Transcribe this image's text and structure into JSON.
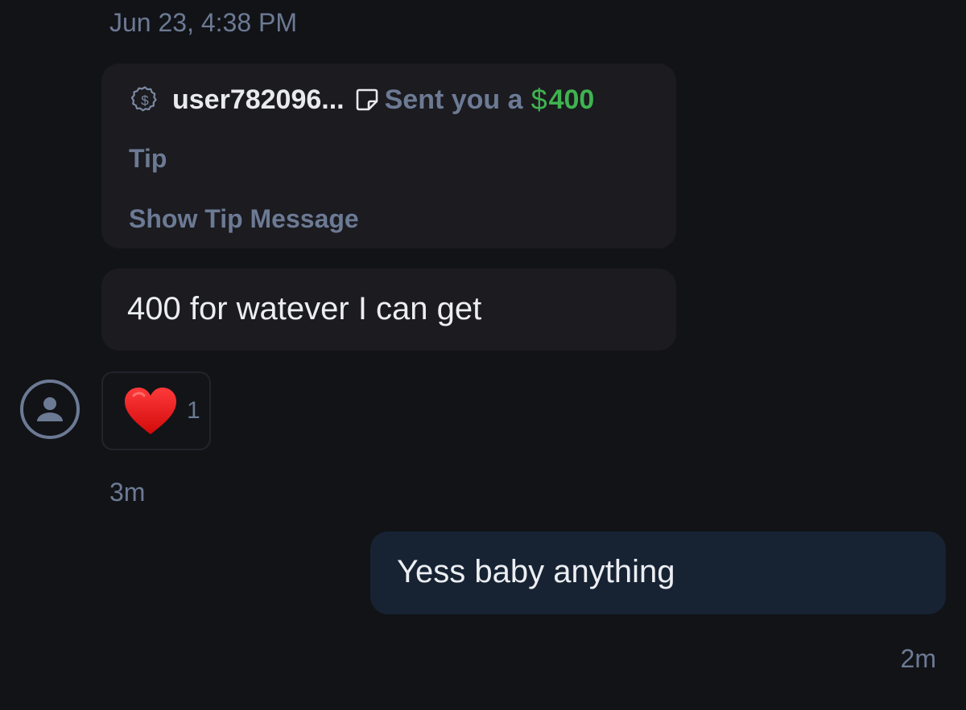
{
  "conversation": {
    "date_header": "Jun 23, 4:38 PM"
  },
  "tip": {
    "icon": "dollar-badge-icon",
    "username": "user782096...",
    "note_icon": "note-icon",
    "sent_text": "Sent you a",
    "currency_symbol": "$",
    "amount": "400",
    "amount_color": "#3fb34f",
    "label": "Tip",
    "show_message_label": "Show Tip Message"
  },
  "incoming_message": {
    "text": "400 for watever I can get",
    "reaction": {
      "icon": "heart-icon",
      "count": "1"
    },
    "time": "3m"
  },
  "outgoing_message": {
    "text": "Yess baby anything",
    "time": "2m"
  },
  "colors": {
    "background": "#121317",
    "bubble_incoming": "#1b1b20",
    "bubble_outgoing": "#172333",
    "muted_text": "#6c7a94",
    "accent_green": "#3fb34f"
  }
}
